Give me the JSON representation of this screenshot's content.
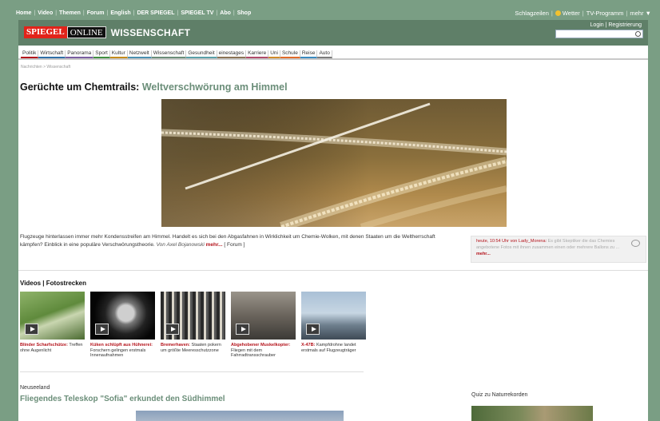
{
  "topbar": {
    "left_links": [
      "Home",
      "Video",
      "Themen",
      "Forum",
      "English",
      "DER SPIEGEL",
      "SPIEGEL TV",
      "Abo",
      "Shop"
    ],
    "right_links": [
      "Schlagzeilen",
      "Wetter",
      "TV-Programm",
      "mehr ▼"
    ]
  },
  "header": {
    "logo_spiegel": "SPIEGEL",
    "logo_online": "ONLINE",
    "section": "WISSENSCHAFT",
    "login": "Login | Registrierung"
  },
  "nav": [
    "Politik",
    "Wirtschaft",
    "Panorama",
    "Sport",
    "Kultur",
    "Netzwelt",
    "Wissenschaft",
    "Gesundheit",
    "einestages",
    "Karriere",
    "Uni",
    "Schule",
    "Reise",
    "Auto"
  ],
  "breadcrumb": "Nachrichten > Wissenschaft",
  "article": {
    "headline_prefix": "Gerüchte um Chemtrails:",
    "headline": "Weltverschwörung am Himmel",
    "teaser": "Flugzeuge hinterlassen immer mehr Kondensstreifen am Himmel. Handelt es sich bei den Abgasfahnen in Wirklichkeit um Chemie-Wolken, mit denen Staaten um die Weltherrschaft kämpfen? Einblick in eine populäre Verschwörungstheorie.",
    "author": "Von Axel Bojanowski",
    "more": "mehr...",
    "forum": "[ Forum ]"
  },
  "comment": {
    "meta": "heute, 10:54 Uhr von Lady_Morena:",
    "text": "Es gibt Skeptiker die das Chemies angebotene Fotos mit ihnen zusammen einen oder mehrere Ballons zu ...",
    "more": "mehr..."
  },
  "videos": {
    "title": "Videos | Fotostrecken",
    "items": [
      {
        "title": "Blinder Scharfschütze:",
        "text": "Treffen ohne Augenlicht"
      },
      {
        "title": "Küken schlüpft aus Hühnerei:",
        "text": "Forschern gelingen erstmals Innenaufnahmen"
      },
      {
        "title": "Bremerhaven:",
        "text": "Staaten pokern um größte Meeresschutzzone"
      },
      {
        "title": "Abgehobener Muskelkopter:",
        "text": "Fliegen mit dem Fahrradtransschrauber"
      },
      {
        "title": "X-47B:",
        "text": "Kampfdrohne landet erstmals auf Flugzeugträger"
      }
    ]
  },
  "story2": {
    "kicker": "Neuseeland",
    "title": "Fliegendes Teleskop \"Sofia\" erkundet den Südhimmel"
  },
  "quiz": {
    "title": "Quiz zu Naturrekorden"
  },
  "colors": {
    "background": "#7a9e84",
    "header": "#5f7f68",
    "accent_red": "#b4131b",
    "subhead_green": "#6b8e79"
  }
}
